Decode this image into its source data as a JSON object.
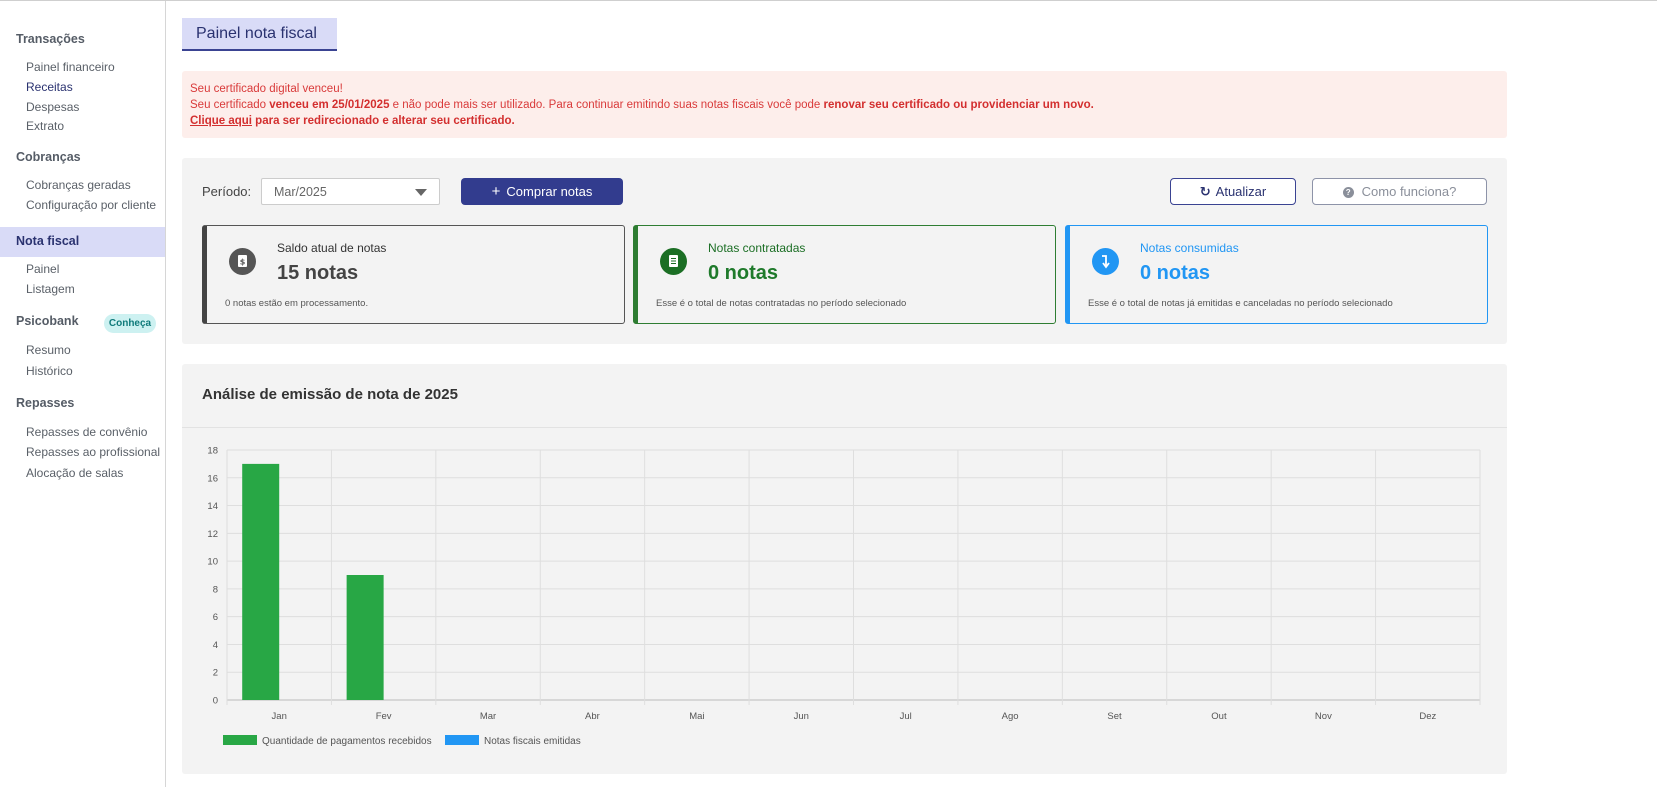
{
  "sidebar": {
    "sections": [
      {
        "label": "Transações",
        "items": [
          "Painel financeiro",
          "Receitas",
          "Despesas",
          "Extrato"
        ]
      },
      {
        "label": "Cobranças",
        "items": [
          "Cobranças geradas",
          "Configuração por cliente"
        ]
      },
      {
        "label": "Nota fiscal",
        "items": [
          "Painel",
          "Listagem"
        ]
      },
      {
        "label": "Psicobank",
        "badge": "Conheça",
        "items": [
          "Resumo",
          "Histórico"
        ]
      },
      {
        "label": "Repasses",
        "items": [
          "Repasses de convênio",
          "Repasses ao profissional",
          "Alocação de salas"
        ]
      }
    ],
    "active_section": "Nota fiscal"
  },
  "page": {
    "title": "Painel nota fiscal"
  },
  "alert": {
    "line1": "Seu certificado digital venceu!",
    "line2_a": "Seu certificado ",
    "line2_b": "venceu em 25/01/2025",
    "line2_c": " e não pode mais ser utilizado. Para continuar emitindo suas notas fiscais você pode ",
    "line2_d": "renovar seu certificado ou providenciar um novo.",
    "line3_link": "Clique aqui",
    "line3_rest": " para ser redirecionado e alterar seu certificado."
  },
  "controls": {
    "periodo_label": "Período:",
    "periodo_value": "Mar/2025",
    "buy_label": "Comprar notas",
    "update_label": "Atualizar",
    "how_label": "Como funciona?"
  },
  "cards": [
    {
      "title": "Saldo atual de notas",
      "value": "15 notas",
      "note": "0 notas estão em processamento.",
      "icon": "dollar-document-icon"
    },
    {
      "title": "Notas contratadas",
      "value": "0 notas",
      "note": "Esse é o total de notas contratadas no período selecionado",
      "icon": "document-icon"
    },
    {
      "title": "Notas consumidas",
      "value": "0 notas",
      "note": "Esse é o total de notas já emitidas e canceladas no período selecionado",
      "icon": "arrow-down-icon"
    }
  ],
  "colors": {
    "accent": "#323c8e",
    "alert": "#d93a3a",
    "green_series": "#28a745",
    "blue_series": "#2196f3"
  },
  "chart_data": {
    "type": "bar",
    "title": "Análise de emissão de nota de 2025",
    "categories": [
      "Jan",
      "Fev",
      "Mar",
      "Abr",
      "Mai",
      "Jun",
      "Jul",
      "Ago",
      "Set",
      "Out",
      "Nov",
      "Dez"
    ],
    "series": [
      {
        "name": "Quantidade de pagamentos recebidos",
        "color": "#28a745",
        "values": [
          17,
          9,
          0,
          0,
          0,
          0,
          0,
          0,
          0,
          0,
          0,
          0
        ]
      },
      {
        "name": "Notas fiscais emitidas",
        "color": "#2196f3",
        "values": [
          0,
          0,
          0,
          0,
          0,
          0,
          0,
          0,
          0,
          0,
          0,
          0
        ]
      }
    ],
    "ylim": [
      0,
      18
    ],
    "yticks": [
      0,
      2,
      4,
      6,
      8,
      10,
      12,
      14,
      16,
      18
    ],
    "grid": true,
    "legend": "bottom-left"
  }
}
